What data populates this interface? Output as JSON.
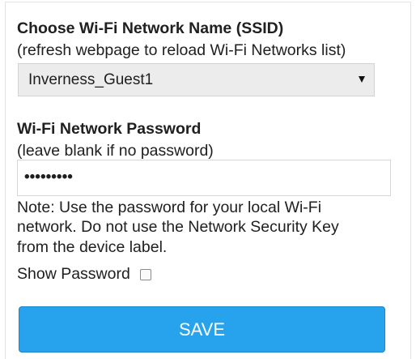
{
  "ssid_section": {
    "title": "Choose Wi-Fi Network Name (SSID)",
    "hint": "(refresh webpage to reload Wi-Fi Networks list)",
    "selected_network": "Inverness_Guest1"
  },
  "password_section": {
    "title": "Wi-Fi Network Password",
    "hint": "(leave blank if no password)",
    "masked_value": "•••••••••",
    "note_lines": [
      "Note: Use the password for your local Wi-Fi",
      "network. Do not use the Network Security Key",
      "from the device label."
    ],
    "show_password_label": "Show Password",
    "show_password_checked": false
  },
  "save_label": "SAVE",
  "colors": {
    "save_button": "#27a3ee",
    "select_background": "#ececec"
  }
}
